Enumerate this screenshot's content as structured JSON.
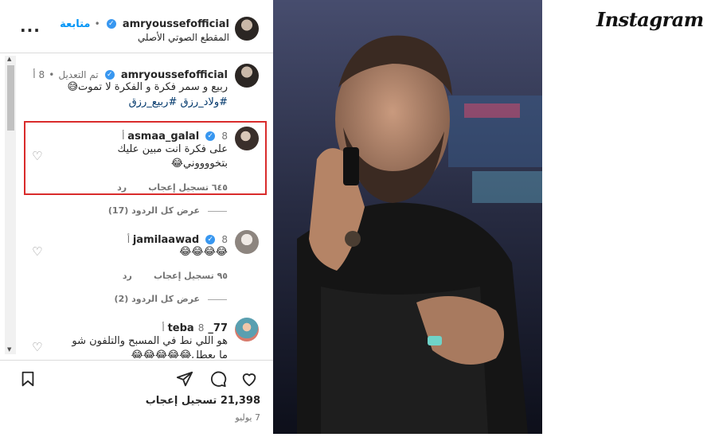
{
  "brand": {
    "logo_text": "Instagram"
  },
  "post_header": {
    "username": "amryoussefofficial",
    "verified_icon": "verified-badge-icon",
    "follow_label": "متابعة",
    "separator": "•",
    "audio_label": "المقطع الصوتي الأصلي",
    "more_icon": "more-options-icon"
  },
  "caption": {
    "username": "amryoussefofficial",
    "edited_label": "تم التعديل",
    "time": "8 أ",
    "line1": "ربيع و سمر فكرة و الفكرة لا تموت😅",
    "hashtags": "#ولاد_رزق #ربيع_رزق"
  },
  "comments": [
    {
      "username": "asmaa_galal",
      "time": "8 أ",
      "line1": "على فكرة انت مبين عليك",
      "line2": "بتخووووني😂",
      "likes": "٦٤٥ تسجيل إعجاب",
      "reply_label": "رد",
      "view_replies": "عرض كل الردود (17)",
      "highlighted": true
    },
    {
      "username": "jamilaawad",
      "time": "8 أ",
      "line1": "😂😂😂😂",
      "likes": "٩٥ تسجيل إعجاب",
      "reply_label": "رد",
      "view_replies": "عرض كل الردود (2)"
    },
    {
      "username": "77_teba",
      "time": "8 أ",
      "line1": "هو اللي نط في المسبح والتلفون شو",
      "line2": "ما بعطل😂😂😂😂😂"
    }
  ],
  "footer": {
    "like_icon": "heart-icon",
    "comment_icon": "comment-icon",
    "share_icon": "send-icon",
    "save_icon": "bookmark-icon",
    "likes_count": "21,398 تسجيل إعجاب",
    "date": "7 يوليو"
  },
  "media": {
    "type": "video-frame"
  },
  "colors": {
    "accent": "#0095f6",
    "highlight": "#d92b2b",
    "text": "#262626",
    "muted": "#737373"
  }
}
